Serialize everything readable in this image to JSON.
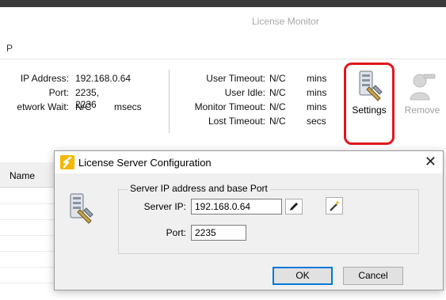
{
  "window": {
    "title": "License Monitor",
    "menu_fragment": "P"
  },
  "server_info": {
    "ip_label": "IP Address:",
    "ip_value": "192.168.0.64",
    "port_label": "Port:",
    "port_value": "2235, 2236",
    "network_wait_label": "etwork Wait:",
    "network_wait_value": "N/C",
    "network_wait_unit": "msecs"
  },
  "timeouts": {
    "user_timeout_label": "User Timeout:",
    "user_timeout_value": "N/C",
    "user_timeout_unit": "mins",
    "user_idle_label": "User Idle:",
    "user_idle_value": "N/C",
    "user_idle_unit": "mins",
    "monitor_timeout_label": "Monitor Timeout:",
    "monitor_timeout_value": "N/C",
    "monitor_timeout_unit": "mins",
    "lost_timeout_label": "Lost Timeout:",
    "lost_timeout_value": "N/C",
    "lost_timeout_unit": "secs"
  },
  "toolbar": {
    "settings_label": "Settings",
    "remove_label": "Remove"
  },
  "list": {
    "name_header": "Name"
  },
  "dialog": {
    "title": "License Server Configuration",
    "close_glyph": "✕",
    "group_label": "Server IP address and base Port",
    "server_ip_label": "Server IP:",
    "server_ip_value": "192.168.0.64",
    "port_label": "Port:",
    "port_value": "2235",
    "ok_label": "OK",
    "cancel_label": "Cancel"
  },
  "colors": {
    "highlight": "#e0161c",
    "focus_border": "#0078d7",
    "title_text": "#a8a8a8"
  }
}
